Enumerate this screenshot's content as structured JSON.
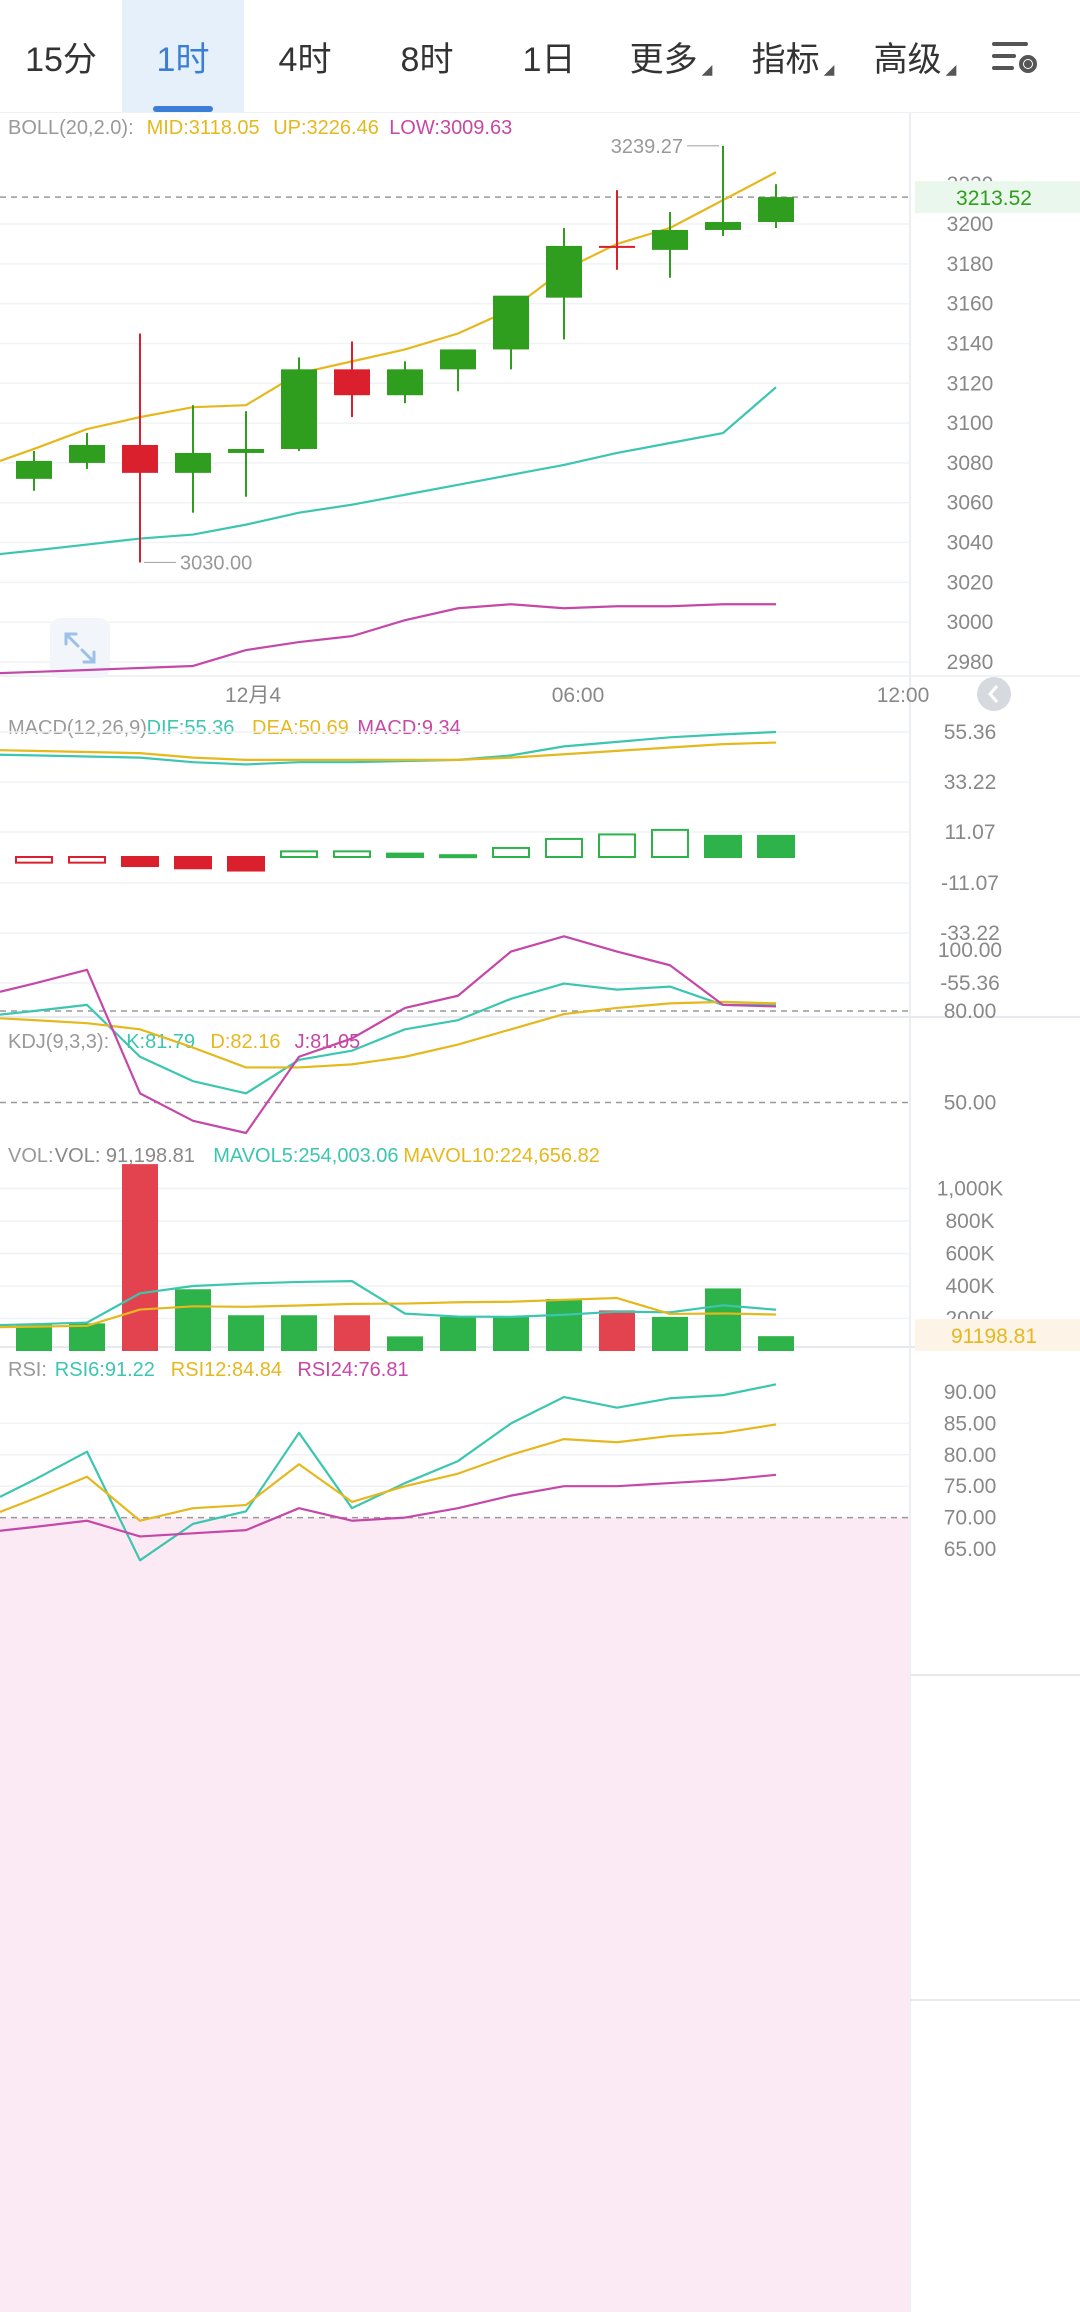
{
  "tabs": [
    {
      "label": "15分",
      "active": false,
      "dropdown": false
    },
    {
      "label": "1时",
      "active": true,
      "dropdown": false
    },
    {
      "label": "4时",
      "active": false,
      "dropdown": false
    },
    {
      "label": "8时",
      "active": false,
      "dropdown": false
    },
    {
      "label": "1日",
      "active": false,
      "dropdown": false
    },
    {
      "label": "更多",
      "active": false,
      "dropdown": true
    },
    {
      "label": "指标",
      "active": false,
      "dropdown": true
    },
    {
      "label": "高级",
      "active": false,
      "dropdown": true
    }
  ],
  "settings_icon": "chart-settings-icon",
  "colors": {
    "up": "#2f9e1e",
    "down": "#d9202c",
    "mid": "#e5b81e",
    "low": "#3cc6b0",
    "up_band": "#c548a8",
    "vol_up": "#2db34a",
    "vol_down": "#e2434f"
  },
  "chart_data": [
    {
      "type": "candlestick",
      "title": "BOLL(20,2.0):",
      "legend": [
        {
          "name": "MID",
          "text": "MID:3118.05",
          "color": "#e5b81e"
        },
        {
          "name": "UP",
          "text": "UP:3226.46",
          "color": "#e5b81e"
        },
        {
          "name": "LOW",
          "text": "LOW:3009.63",
          "color": "#c548a8"
        }
      ],
      "ylim": [
        2970,
        3255
      ],
      "yticks": [
        3200,
        3180,
        3160,
        3140,
        3120,
        3100,
        3080,
        3060,
        3040,
        3020,
        3000,
        2980
      ],
      "yticks_labels": [
        "3220",
        "3200",
        "3180",
        "3160",
        "3140",
        "3120",
        "3100",
        "3080",
        "3060",
        "3040",
        "3020",
        "3000",
        "2980"
      ],
      "xticks": [
        {
          "index": 4.5,
          "label": "12月4"
        },
        {
          "index": 10.5,
          "label": "06:00"
        },
        {
          "index": 16.5,
          "label": "12:00"
        }
      ],
      "candles": [
        {
          "o": 3072,
          "h": 3086,
          "l": 3066,
          "c": 3081
        },
        {
          "o": 3080,
          "h": 3095,
          "l": 3077,
          "c": 3089
        },
        {
          "o": 3089,
          "h": 3145,
          "l": 3030,
          "c": 3075
        },
        {
          "o": 3075,
          "h": 3109,
          "l": 3055,
          "c": 3085
        },
        {
          "o": 3085,
          "h": 3106,
          "l": 3063,
          "c": 3087
        },
        {
          "o": 3087,
          "h": 3133,
          "l": 3086,
          "c": 3127
        },
        {
          "o": 3127,
          "h": 3141,
          "l": 3103,
          "c": 3114
        },
        {
          "o": 3114,
          "h": 3131,
          "l": 3110,
          "c": 3127
        },
        {
          "o": 3127,
          "h": 3137,
          "l": 3116,
          "c": 3137
        },
        {
          "o": 3137,
          "h": 3162,
          "l": 3127,
          "c": 3164
        },
        {
          "o": 3163,
          "h": 3198,
          "l": 3142,
          "c": 3189
        },
        {
          "o": 3189,
          "h": 3217,
          "l": 3177,
          "c": 3188
        },
        {
          "o": 3187,
          "h": 3206,
          "l": 3173,
          "c": 3197
        },
        {
          "o": 3197,
          "h": 3239.27,
          "l": 3194,
          "c": 3201
        },
        {
          "o": 3201,
          "h": 3220,
          "l": 3198,
          "c": 3213.52
        }
      ],
      "series": [
        {
          "name": "UP",
          "color": "#e5b81e",
          "values": [
            3087,
            3097,
            3103,
            3108,
            3109,
            3125,
            3131,
            3137,
            3145,
            3157,
            3177,
            3190,
            3198,
            3212,
            3226
          ]
        },
        {
          "name": "MID",
          "color": "#3cc6b0",
          "values": [
            3036,
            3039,
            3042,
            3044,
            3049,
            3055,
            3059,
            3064,
            3069,
            3074,
            3079,
            3085,
            3090,
            3095,
            3118
          ]
        },
        {
          "name": "LOW",
          "color": "#c548a8",
          "values": [
            2975,
            2976,
            2977,
            2978,
            2986,
            2990,
            2993,
            3001,
            3007,
            3009,
            3007,
            3008,
            3008,
            3009,
            3009
          ]
        }
      ],
      "annotations": [
        {
          "text": "3239.27",
          "at_index": 13,
          "value": 3239.27
        },
        {
          "text": "3030.00",
          "at_index": 2,
          "value": 3030
        }
      ],
      "current_price": {
        "text": "3213.52",
        "value": 3213.52
      }
    },
    {
      "type": "macd",
      "title": "MACD(12,26,9)",
      "legend": [
        {
          "name": "DIF",
          "text": "DIF:55.36",
          "color": "#3cc6b0"
        },
        {
          "name": "DEA",
          "text": "DEA:50.69",
          "color": "#e5b81e"
        },
        {
          "name": "MACD",
          "text": "MACD:9.34",
          "color": "#c548a8"
        }
      ],
      "yticks_labels": [
        "55.36",
        "33.22",
        "11.07",
        "-11.07",
        "-33.22",
        "-55.36"
      ],
      "ylim": [
        -55.36,
        55.36
      ],
      "bars": [
        -2.5,
        -2.5,
        -4,
        -5,
        -6,
        2.5,
        2.5,
        1.5,
        0.8,
        4,
        8,
        10,
        12,
        9.34,
        9.34
      ],
      "bars_filled": [
        false,
        false,
        true,
        true,
        true,
        false,
        false,
        true,
        true,
        false,
        false,
        false,
        false,
        true,
        true
      ],
      "series": [
        {
          "name": "DIF",
          "color": "#3cc6b0",
          "values": [
            45,
            44.5,
            44,
            42,
            41,
            42,
            42,
            42.5,
            43,
            45,
            49,
            51,
            53,
            54.3,
            55.36
          ]
        },
        {
          "name": "DEA",
          "color": "#e5b81e",
          "values": [
            47,
            46.5,
            46,
            44,
            43,
            43,
            43,
            43,
            43,
            44,
            45.5,
            47,
            48.5,
            50,
            50.69
          ]
        }
      ]
    },
    {
      "type": "kdj",
      "title": "KDJ(9,3,3):",
      "legend": [
        {
          "name": "K",
          "text": "K:81.79",
          "color": "#3cc6b0"
        },
        {
          "name": "D",
          "text": "D:82.16",
          "color": "#e5b81e"
        },
        {
          "name": "J",
          "text": "J:81.05",
          "color": "#c548a8"
        }
      ],
      "yticks_labels": [
        "100.00",
        "80.00",
        "50.00"
      ],
      "ylim": [
        40,
        105
      ],
      "series": [
        {
          "name": "K",
          "color": "#3cc6b0",
          "values": [
            80,
            82,
            65,
            57,
            53,
            64,
            67,
            74,
            77,
            84,
            89,
            87,
            88,
            82,
            82
          ]
        },
        {
          "name": "D",
          "color": "#e5b81e",
          "values": [
            77,
            76,
            74,
            68,
            61.5,
            61.5,
            62.5,
            65,
            69,
            74,
            79,
            81,
            82.5,
            83,
            82.5
          ]
        },
        {
          "name": "J",
          "color": "#c548a8",
          "values": [
            89,
            93.5,
            53,
            44,
            40,
            65,
            71,
            81,
            85,
            99.5,
            104.5,
            99.5,
            95,
            82,
            81.5
          ]
        }
      ]
    },
    {
      "type": "volume",
      "title": "VOL:",
      "legend": [
        {
          "name": "VOL",
          "text": "VOL: 91,198.81",
          "color": "#888888"
        },
        {
          "name": "MAVOL5",
          "text": "MAVOL5:254,003.06",
          "color": "#3cc6b0"
        },
        {
          "name": "MAVOL10",
          "text": "MAVOL10:224,656.82",
          "color": "#e5b81e"
        }
      ],
      "yticks_labels": [
        "1,000K",
        "800K",
        "600K",
        "400K",
        "200K"
      ],
      "ylim": [
        0,
        1150000
      ],
      "bars": [
        165000,
        170000,
        1150000,
        380000,
        220000,
        220000,
        220000,
        90000,
        210000,
        210000,
        320000,
        250000,
        210000,
        385000,
        91198.81
      ],
      "bars_color": [
        "up",
        "up",
        "down",
        "up",
        "up",
        "up",
        "down",
        "up",
        "up",
        "up",
        "up",
        "down",
        "up",
        "up",
        "up"
      ],
      "series": [
        {
          "name": "MAVOL5",
          "color": "#3cc6b0",
          "values": [
            165000,
            175000,
            355000,
            400000,
            415000,
            425000,
            430000,
            230000,
            212000,
            210000,
            223000,
            242000,
            238000,
            281000,
            254003
          ]
        },
        {
          "name": "MAVOL10",
          "color": "#e5b81e",
          "values": [
            150000,
            155000,
            255000,
            275000,
            272000,
            280000,
            290000,
            292000,
            300000,
            303000,
            315000,
            326000,
            228000,
            231000,
            224657
          ]
        }
      ],
      "current_value": "91198.81"
    },
    {
      "type": "rsi",
      "title": "RSI:",
      "legend": [
        {
          "name": "RSI6",
          "text": "RSI6:91.22",
          "color": "#3cc6b0"
        },
        {
          "name": "RSI12",
          "text": "RSI12:84.84",
          "color": "#e5b81e"
        },
        {
          "name": "RSI24",
          "text": "RSI24:76.81",
          "color": "#c548a8"
        }
      ],
      "yticks_labels": [
        "90.00",
        "85.00",
        "80.00",
        "75.00",
        "70.00",
        "65.00"
      ],
      "ylim": [
        63,
        93
      ],
      "oversold_band": [
        63,
        70
      ],
      "series": [
        {
          "name": "RSI6",
          "color": "#3cc6b0",
          "values": [
            76,
            80.5,
            63.2,
            69,
            71,
            83.5,
            71.5,
            75.5,
            79,
            85,
            89.2,
            87.5,
            89,
            89.5,
            91.22
          ]
        },
        {
          "name": "RSI12",
          "color": "#e5b81e",
          "values": [
            73,
            76.5,
            69.5,
            71.5,
            72,
            78.5,
            72.5,
            75,
            77,
            80,
            82.5,
            82,
            83,
            83.5,
            84.84
          ]
        },
        {
          "name": "RSI24",
          "color": "#c548a8",
          "values": [
            68.5,
            69.5,
            67,
            67.5,
            68,
            71.5,
            69.5,
            70,
            71.5,
            73.5,
            75,
            75,
            75.5,
            76,
            76.81
          ]
        }
      ]
    }
  ]
}
